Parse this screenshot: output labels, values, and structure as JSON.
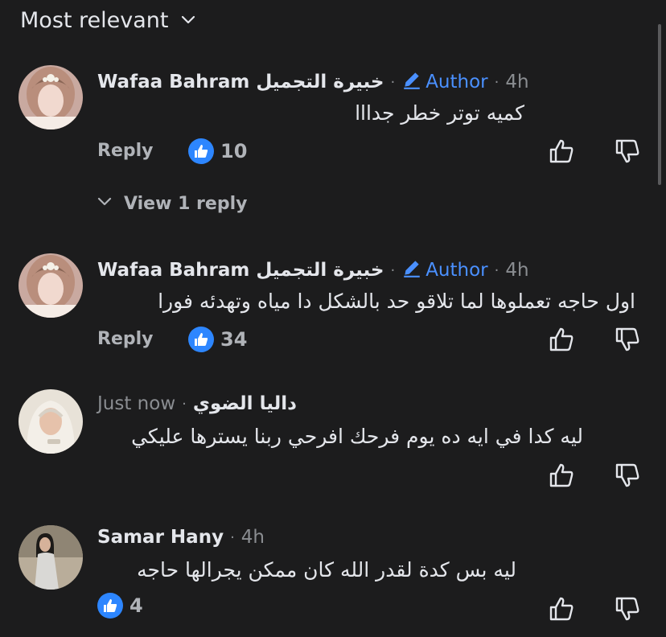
{
  "sort": {
    "label": "Most relevant"
  },
  "comments": [
    {
      "name": "Wafaa Bahram خبيرة  التجميل",
      "badge": "Author",
      "time": "4h",
      "text": "كميه توتر خطر جدااا",
      "reply_label": "Reply",
      "likes": "10",
      "view_replies": "View 1 reply"
    },
    {
      "name": "Wafaa Bahram خبيرة  التجميل",
      "badge": "Author",
      "time": "4h",
      "text": "اول حاجه تعملوها لما تلاقو حد بالشكل دا مياه وتهدئه فورا",
      "reply_label": "Reply",
      "likes": "34"
    },
    {
      "name": "داليا  الضوي",
      "time": "Just now",
      "text": "ليه كدا في ايه ده يوم فرحك افرحي ربنا يسترها عليكي"
    },
    {
      "name": "Samar Hany",
      "time": "4h",
      "text": "ليه بس كدة لقدر الله كان ممكن يجرالها حاجه",
      "likes": "4"
    }
  ],
  "colors": {
    "background": "#1c1c1d",
    "accent": "#4a90ff",
    "like_bubble": "#2d86ff"
  },
  "icons": [
    "chevron-down-icon",
    "pencil-icon",
    "like-icon",
    "thumbs-up-icon",
    "thumbs-down-icon"
  ]
}
